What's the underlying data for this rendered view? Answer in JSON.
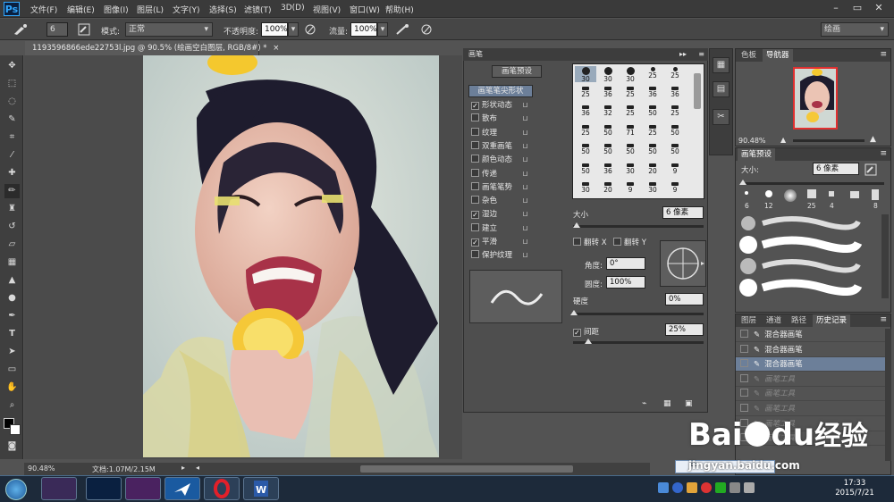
{
  "app": {
    "logo": "Ps",
    "menu": [
      "文件(F)",
      "编辑(E)",
      "图像(I)",
      "图层(L)",
      "文字(Y)",
      "选择(S)",
      "滤镜(T)",
      "3D(D)",
      "视图(V)",
      "窗口(W)",
      "帮助(H)"
    ],
    "window_controls": [
      "–",
      "▭",
      "✕"
    ]
  },
  "options": {
    "brush_size": "6",
    "mode_label": "模式:",
    "mode_value": "正常",
    "opacity_label": "不透明度:",
    "opacity_value": "100%",
    "flow_label": "流量:",
    "flow_value": "100%",
    "workspace_value": "绘画"
  },
  "document": {
    "tab_title": "1193596866ede22753l.jpg @ 90.5% (绘画空白图层, RGB/8#) *",
    "close": "×",
    "zoom": "90.48%",
    "doc_info": "文档:1.07M/2.15M"
  },
  "brush_panel": {
    "title": "画笔",
    "presets_button": "画笔预设",
    "tip_shape_header": "画笔笔尖形状",
    "options": [
      {
        "label": "形状动态",
        "checked": true
      },
      {
        "label": "散布",
        "checked": false
      },
      {
        "label": "纹理",
        "checked": false
      },
      {
        "label": "双重画笔",
        "checked": false
      },
      {
        "label": "颜色动态",
        "checked": false
      },
      {
        "label": "传递",
        "checked": false
      },
      {
        "label": "画笔笔势",
        "checked": false
      },
      {
        "label": "杂色",
        "checked": false
      },
      {
        "label": "湿边",
        "checked": true
      },
      {
        "label": "建立",
        "checked": false
      },
      {
        "label": "平滑",
        "checked": true
      },
      {
        "label": "保护纹理",
        "checked": false
      }
    ],
    "tip_sizes": [
      [
        "30",
        "30",
        "30",
        "25",
        "25"
      ],
      [
        "25",
        "36",
        "25",
        "36",
        "36"
      ],
      [
        "36",
        "32",
        "25",
        "50",
        "25"
      ],
      [
        "25",
        "50",
        "71",
        "25",
        "50"
      ],
      [
        "50",
        "50",
        "50",
        "50",
        "50"
      ],
      [
        "50",
        "36",
        "30",
        "20",
        "9"
      ],
      [
        "30",
        "20",
        "9",
        "30",
        "9"
      ]
    ],
    "size_label": "大小",
    "size_value": "6 像素",
    "flip_x": "翻转 X",
    "flip_y": "翻转 Y",
    "angle_label": "角度:",
    "angle_value": "0°",
    "roundness_label": "圆度:",
    "roundness_value": "100%",
    "hardness_label": "硬度",
    "hardness_value": "0%",
    "spacing_label": "间距",
    "spacing_value": "25%",
    "spacing_checked": true
  },
  "navigator": {
    "tabs": [
      "色板",
      "导航器"
    ],
    "zoom": "90.48%"
  },
  "brush_presets": {
    "title": "画笔预设",
    "size_label": "大小:",
    "size_value": "6 像素",
    "thumb_sizes": [
      "6",
      "12",
      "",
      "25",
      "4",
      "",
      "8"
    ]
  },
  "history": {
    "tabs": [
      "图层",
      "通道",
      "路径",
      "历史记录"
    ],
    "items": [
      {
        "label": "混合器画笔",
        "state": "normal"
      },
      {
        "label": "混合器画笔",
        "state": "normal"
      },
      {
        "label": "混合器画笔",
        "state": "selected"
      },
      {
        "label": "画笔工具",
        "state": "dimmed"
      },
      {
        "label": "画笔工具",
        "state": "dimmed"
      },
      {
        "label": "画笔工具",
        "state": "dimmed"
      },
      {
        "label": "画笔工具",
        "state": "dimmed"
      },
      {
        "label": "画笔工具",
        "state": "dimmed"
      }
    ]
  },
  "taskbar": {
    "ime_label": "中",
    "clock_time": "17:33",
    "clock_date": "2015/7/21",
    "overlay_baidu": "Bai",
    "overlay_du": "du",
    "overlay_jingyan": "经验",
    "overlay_url": "jingyan.baidu.com"
  },
  "colors": {
    "ps_blue": "#31a8ff",
    "selection": "#6c7f99"
  }
}
